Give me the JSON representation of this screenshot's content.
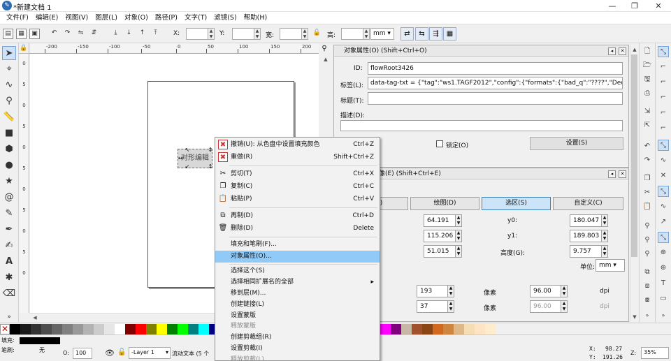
{
  "window": {
    "title": "*新建文档 1",
    "logo_glyph": "✎",
    "minimize": "—",
    "maximize": "❐",
    "close": "✕"
  },
  "menubar": [
    "文件(F)",
    "编辑(E)",
    "视图(V)",
    "图层(L)",
    "对象(O)",
    "路径(P)",
    "文字(T)",
    "滤镜(S)",
    "帮助(H)"
  ],
  "toolbar": {
    "x_label": "X:",
    "y_label": "Y:",
    "w_label": "宽:",
    "h_label": "高:",
    "x_value": "",
    "y_value": "",
    "w_value": "",
    "h_value": "",
    "unit": "mm"
  },
  "rulers": {
    "h_labels": [
      "-200",
      "-150",
      "-100",
      "-50",
      "0",
      "50",
      "100",
      "150",
      "200"
    ],
    "v_labels": [
      "0",
      "5",
      "0",
      "5",
      "0",
      "5",
      "0",
      "5",
      "0",
      "5",
      "0"
    ]
  },
  "canvas": {
    "text_object": "对形编辑"
  },
  "object_properties": {
    "title": "对象属性(O) (Shift+Ctrl+O)",
    "id_label": "ID:",
    "id_value": "flowRoot3426",
    "label_label": "标签(L):",
    "label_value": "data-tag-txt = {\"tag\":\"ws1.TAGF2012\",\"config\":{\"formats\":{\"bad_q\":\"????\",\"Decimal\":\"",
    "title_label": "标题(T):",
    "title_value": "",
    "desc_label": "描述(D):",
    "lock_label": "锁定(O)",
    "set_button": "设置(S)"
  },
  "export_panel": {
    "title": "像(E) (Shift+Ctrl+E)",
    "tabs": [
      "页面(P)",
      "绘图(D)",
      "选区(S)",
      "自定义(C)"
    ],
    "selected_tab": 2,
    "x0": "64.191",
    "y0_label": "y0:",
    "y0": "180.047",
    "x1": "115.206",
    "y1_label": "y1:",
    "y1": "189.803",
    "width": "51.015",
    "height_label": "高度(G):",
    "height": "9.757",
    "unit_label": "单位:",
    "unit": "mm",
    "px_w": "193",
    "px_label": "像素",
    "dpi_w": "96.00",
    "dpi_label": "dpi",
    "px_h": "37",
    "px_label2": "像素",
    "dpi_h": "96.00",
    "dpi_label2": "dpi"
  },
  "context_menu": {
    "items": [
      {
        "icon": "✖",
        "label": "撤销(U): 从色盘中设置填充颜色",
        "accel": "Ctrl+Z",
        "state": "normal"
      },
      {
        "icon": "✖",
        "label": "重做(R)",
        "accel": "Shift+Ctrl+Z",
        "state": "normal"
      },
      {
        "icon": "✂",
        "label": "剪切(T)",
        "accel": "Ctrl+X",
        "state": "normal"
      },
      {
        "icon": "❐",
        "label": "复制(C)",
        "accel": "Ctrl+C",
        "state": "normal"
      },
      {
        "icon": "📋",
        "label": "粘贴(P)",
        "accel": "Ctrl+V",
        "state": "normal"
      },
      {
        "icon": "⧉",
        "label": "再制(D)",
        "accel": "Ctrl+D",
        "state": "normal"
      },
      {
        "icon": "🗑",
        "label": "删除(D)",
        "accel": "Delete",
        "state": "normal"
      },
      {
        "icon": "",
        "label": "填充和笔刷(F)...",
        "accel": "",
        "state": "normal"
      },
      {
        "icon": "",
        "label": "对象属性(O)...",
        "accel": "",
        "state": "highlighted"
      },
      {
        "icon": "",
        "label": "选择这个(S)",
        "accel": "",
        "state": "normal"
      },
      {
        "icon": "",
        "label": "选择相同扩展名的全部",
        "accel": "▸",
        "state": "normal"
      },
      {
        "icon": "",
        "label": "移到层(M)...",
        "accel": "",
        "state": "normal"
      },
      {
        "icon": "",
        "label": "创建链接(L)",
        "accel": "",
        "state": "normal"
      },
      {
        "icon": "",
        "label": "设置蒙版",
        "accel": "",
        "state": "normal"
      },
      {
        "icon": "",
        "label": "释放蒙版",
        "accel": "",
        "state": "disabled"
      },
      {
        "icon": "",
        "label": "创建剪裁组(R)",
        "accel": "",
        "state": "normal"
      },
      {
        "icon": "",
        "label": "设置剪裁(I)",
        "accel": "",
        "state": "normal"
      },
      {
        "icon": "",
        "label": "释放剪裁(L)",
        "accel": "",
        "state": "disabled"
      }
    ]
  },
  "palette": [
    "#000000",
    "#1a1a1a",
    "#333333",
    "#4d4d4d",
    "#666666",
    "#808080",
    "#999999",
    "#b3b3b3",
    "#cccccc",
    "#e6e6e6",
    "#ffffff",
    "#800000",
    "#ff0000",
    "#808000",
    "#ffff00",
    "#008000",
    "#00ff00",
    "#008080",
    "#00ffff",
    "#000080"
  ],
  "palette_right": [
    "#ff00ff",
    "#800080",
    "#c8b7a6",
    "#a0522d",
    "#8b4513",
    "#d2691e",
    "#cd853f",
    "#deb887",
    "#f5deb3",
    "#ffe4c4",
    "#ffebcd"
  ],
  "statusbar": {
    "fill_label": "填充:",
    "stroke_label": "笔刷:",
    "stroke_value": "无",
    "opacity_label": "O:",
    "opacity_value": "100",
    "layer_value": "-Layer 1",
    "message": "流动文本 (5 个",
    "x_label": "X:",
    "x_value": "98.27",
    "y_label": "Y:",
    "y_value": "191.26",
    "zoom_label": "Z:",
    "zoom_value": "35%"
  }
}
